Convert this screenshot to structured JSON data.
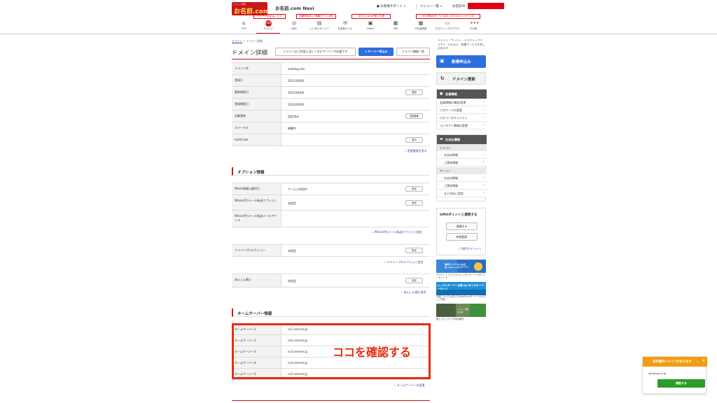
{
  "header": {
    "logo_tagline": "ドメイン登録",
    "logo_text": "お名前.com",
    "title": "お名前.com Navi",
    "support": "お客様サポート",
    "menu": "メニュー一覧",
    "member_id_label": "お名前ID"
  },
  "banners": [
    "ドメイン設定はこちら",
    "初期費用なし!価格ダウン!(例)",
    "今なら.comが更にお得",
    "MT4専用VPS「1.5GB」2021キャンペーン中"
  ],
  "nav": [
    {
      "label": "TOP",
      "icon": "home-icon",
      "glyph": "⌂"
    },
    {
      "label": "ドメイン",
      "icon": "domain-icon",
      "glyph": "com"
    },
    {
      "label": "DNS",
      "icon": "globe-icon",
      "glyph": "◎"
    },
    {
      "label": "レンタルサーバー",
      "icon": "server-icon",
      "glyph": "▤"
    },
    {
      "label": "お名前メール",
      "icon": "mail-icon",
      "glyph": "✉"
    },
    {
      "label": "Office",
      "icon": "office-icon",
      "glyph": "▣"
    },
    {
      "label": "VPS",
      "icon": "vps-icon",
      "glyph": "▦"
    },
    {
      "label": "SSL証明書",
      "icon": "ssl-icon",
      "glyph": "▩"
    },
    {
      "label": "デスクトップクラウド",
      "icon": "desktop-icon",
      "glyph": "▭"
    },
    {
      "label": "その他",
      "icon": "more-icon",
      "glyph": "•••"
    }
  ],
  "breadcrumb": {
    "home": "ドメイン",
    "sep": ">",
    "current": "ドメイン詳細"
  },
  "page": {
    "title": "ドメイン詳細",
    "notice_button": "ドメインのご利用にはレンタルサーバーが必要です",
    "server_apply_button": "サーバー申込み",
    "domain_list_button": "ドメイン機能一覧"
  },
  "domain_info": {
    "rows": [
      {
        "label": "ドメイン名",
        "value": "saltolog.site",
        "button": ""
      },
      {
        "label": "登録日",
        "value": "2021/04/06",
        "button": ""
      },
      {
        "label": "更新期限日",
        "value": "2022/04/06",
        "button": "更新"
      },
      {
        "label": "登録期限日",
        "value": "2022/04/06",
        "button": ""
      },
      {
        "label": "自動更新",
        "value": "設定済み",
        "button": "自動更新"
      },
      {
        "label": "ステータス",
        "value": "稼働中",
        "button": ""
      },
      {
        "label": "AuthCode",
        "value": "",
        "button": "表示"
      }
    ],
    "history_link": "変更履歴を見る"
  },
  "options": {
    "title": "オプション情報",
    "whois_rows": [
      {
        "label": "Whois情報公開代行",
        "value": "サービス利用中",
        "button": "設定"
      },
      {
        "label": "Whois代行メール転送オプション",
        "value": "未設定",
        "button": "設定"
      },
      {
        "label": "Whois代行メール転送メールアドレス",
        "value": "",
        "button": ""
      }
    ],
    "whois_link": "Whois代行メール転送オプション設定",
    "protection": {
      "label": "ドメインプロテクション",
      "value": "未設定",
      "button": "設定"
    },
    "protection_link": "ドメインプロテクション設定",
    "anshin": {
      "label": "あんしん廃止",
      "value": "未設定",
      "button": "設定"
    },
    "anshin_link": "あんしん廃止設定"
  },
  "nameservers": {
    "title": "ネームサーバー情報",
    "rows": [
      {
        "label": "ネームサーバー1",
        "value": "ns1.xserver.jp"
      },
      {
        "label": "ネームサーバー2",
        "value": "ns2.xserver.jp"
      },
      {
        "label": "ネームサーバー3",
        "value": "ns3.xserver.jp"
      },
      {
        "label": "ネームサーバー4",
        "value": "ns4.xserver.jp"
      },
      {
        "label": "ネームサーバー5",
        "value": "ns5.xserver.jp"
      }
    ],
    "change_link": "ネームサーバーの変更",
    "annotation": "ココを確認する"
  },
  "sidebar": {
    "intro": "ドメイン・サーバー・デスクトップクラウド・SSLなど、各種サービスを申し込めます",
    "new_button": "新規申込み",
    "renew_button": "ドメイン更新",
    "member": {
      "title": "会員情報",
      "items": [
        "会員情報の確認/変更",
        "パスワードの変更",
        "ログインセキュリティ",
        "コンタクト情報の変更"
      ]
    },
    "payment": {
      "title": "お支払情報",
      "domain_group": "ドメイン",
      "domain_items": [
        "お支払情報",
        "ご請求情報"
      ],
      "server_group": "サーバー",
      "server_items": [
        "お支払情報",
        "ご請求情報",
        "まとめ払い設定"
      ]
    },
    "gmo": {
      "title": "GMOポイントと連携する",
      "link_button": "連携する",
      "register_button": "新規登録",
      "points_link": "GMOポイントへ"
    },
    "ads": [
      {
        "caption": "デスクトップ/クラウド/レンタルサーバーRSプランセットで"
      },
      {
        "caption": "手軽にかんたん使えるWordPressサーバーを今すぐご利用"
      },
      {
        "caption": "遊んでガッカリ!お悩み解決"
      }
    ],
    "ad1_text": "無料サーバーならお名前.comレンタルサーバー",
    "ad2_text": "レンタルサーバー比較 はじめてのサーバーガイド",
    "ad3_text": "ドメイン更新もお得"
  },
  "popup": {
    "title": "未申請のドメインがあります",
    "domain": "saltolog.co.jp",
    "confirm_button": "確認する"
  },
  "colors": {
    "brand_red": "#c8161d",
    "accent_blue": "#2e6fde",
    "annotation_red": "#e52d11",
    "popup_orange": "#f39c12",
    "confirm_green": "#2a9d2a"
  }
}
